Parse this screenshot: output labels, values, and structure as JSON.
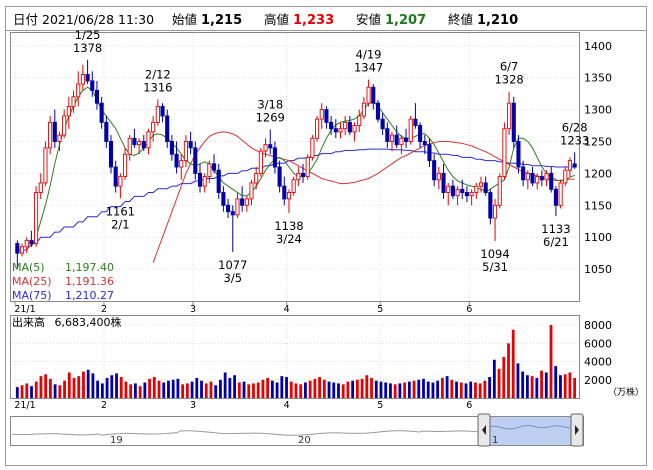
{
  "header": {
    "date_label": "日付",
    "datetime": "2021/06/28 11:30",
    "open_label": "始値",
    "open": "1,215",
    "high_label": "高値",
    "high": "1,233",
    "low_label": "安値",
    "low": "1,207",
    "close_label": "終値",
    "close": "1,210"
  },
  "colors": {
    "up": "#e60000",
    "down": "#0000aa",
    "ma5": "#2e7d1e",
    "ma25": "#e03030",
    "ma75": "#2a2ae0",
    "high_value": "#e60000",
    "low_value": "#1a7a1a",
    "nav_fill": "#a8c0ee"
  },
  "legend": [
    {
      "label": "MA(5)",
      "value": "1,197.40",
      "color": "#2e7d1e"
    },
    {
      "label": "MA(25)",
      "value": "1,191.36",
      "color": "#e03030"
    },
    {
      "label": "MA(75)",
      "value": "1,210.27",
      "color": "#2a2ae0"
    }
  ],
  "volume": {
    "label": "出来高",
    "value": "6,683,400株",
    "unit": "（万株）"
  },
  "x_axis": {
    "main_ticks": [
      "21/1",
      "2",
      "3",
      "4",
      "5",
      "6"
    ],
    "volume_ticks": [
      "21/1",
      "2",
      "3",
      "4",
      "5",
      "6"
    ]
  },
  "navigator": {
    "labels": [
      "19",
      "20",
      "1"
    ]
  },
  "chart_data": [
    {
      "type": "candlestick",
      "title": "",
      "ylim": [
        1000,
        1420
      ],
      "yticks": [
        1050,
        1100,
        1150,
        1200,
        1250,
        1300,
        1350,
        1400
      ],
      "annotations": [
        {
          "date": "1/25",
          "value": 1378,
          "kind": "high"
        },
        {
          "date": "2/12",
          "value": 1316,
          "kind": "high"
        },
        {
          "date": "3/18",
          "value": 1269,
          "kind": "high"
        },
        {
          "date": "4/19",
          "value": 1347,
          "kind": "high"
        },
        {
          "date": "6/7",
          "value": 1328,
          "kind": "high"
        },
        {
          "date": "6/28",
          "value": 1233,
          "kind": "high"
        },
        {
          "date": "2/1",
          "value": 1161,
          "kind": "low"
        },
        {
          "date": "3/5",
          "value": 1077,
          "kind": "low"
        },
        {
          "date": "3/24",
          "value": 1138,
          "kind": "low"
        },
        {
          "date": "5/31",
          "value": 1094,
          "kind": "low"
        },
        {
          "date": "6/21",
          "value": 1133,
          "kind": "low"
        }
      ],
      "ohlc": [
        [
          1090,
          1095,
          1050,
          1075
        ],
        [
          1075,
          1090,
          1070,
          1085
        ],
        [
          1085,
          1100,
          1075,
          1095
        ],
        [
          1095,
          1110,
          1085,
          1090
        ],
        [
          1090,
          1180,
          1085,
          1170
        ],
        [
          1170,
          1200,
          1160,
          1185
        ],
        [
          1185,
          1250,
          1180,
          1240
        ],
        [
          1240,
          1290,
          1230,
          1280
        ],
        [
          1280,
          1300,
          1240,
          1250
        ],
        [
          1250,
          1265,
          1235,
          1260
        ],
        [
          1260,
          1300,
          1255,
          1290
        ],
        [
          1290,
          1320,
          1270,
          1305
        ],
        [
          1305,
          1330,
          1295,
          1320
        ],
        [
          1320,
          1360,
          1305,
          1340
        ],
        [
          1340,
          1370,
          1330,
          1355
        ],
        [
          1355,
          1378,
          1340,
          1345
        ],
        [
          1345,
          1360,
          1320,
          1330
        ],
        [
          1330,
          1345,
          1300,
          1310
        ],
        [
          1310,
          1320,
          1270,
          1280
        ],
        [
          1280,
          1290,
          1240,
          1250
        ],
        [
          1250,
          1260,
          1200,
          1210
        ],
        [
          1210,
          1220,
          1170,
          1180
        ],
        [
          1180,
          1200,
          1161,
          1195
        ],
        [
          1195,
          1240,
          1190,
          1230
        ],
        [
          1230,
          1260,
          1220,
          1255
        ],
        [
          1255,
          1270,
          1240,
          1245
        ],
        [
          1245,
          1255,
          1230,
          1250
        ],
        [
          1250,
          1260,
          1235,
          1240
        ],
        [
          1240,
          1270,
          1230,
          1265
        ],
        [
          1265,
          1290,
          1250,
          1280
        ],
        [
          1280,
          1316,
          1275,
          1305
        ],
        [
          1305,
          1310,
          1280,
          1290
        ],
        [
          1290,
          1300,
          1240,
          1250
        ],
        [
          1250,
          1260,
          1220,
          1230
        ],
        [
          1230,
          1250,
          1200,
          1210
        ],
        [
          1210,
          1230,
          1190,
          1220
        ],
        [
          1220,
          1260,
          1210,
          1250
        ],
        [
          1250,
          1265,
          1230,
          1240
        ],
        [
          1240,
          1250,
          1190,
          1200
        ],
        [
          1200,
          1215,
          1170,
          1180
        ],
        [
          1180,
          1200,
          1170,
          1195
        ],
        [
          1195,
          1220,
          1185,
          1215
        ],
        [
          1215,
          1230,
          1200,
          1205
        ],
        [
          1205,
          1215,
          1160,
          1170
        ],
        [
          1170,
          1180,
          1140,
          1150
        ],
        [
          1150,
          1160,
          1130,
          1140
        ],
        [
          1140,
          1150,
          1077,
          1135
        ],
        [
          1135,
          1170,
          1130,
          1160
        ],
        [
          1160,
          1180,
          1140,
          1150
        ],
        [
          1150,
          1165,
          1140,
          1160
        ],
        [
          1160,
          1190,
          1150,
          1185
        ],
        [
          1185,
          1210,
          1175,
          1200
        ],
        [
          1200,
          1240,
          1195,
          1235
        ],
        [
          1235,
          1255,
          1225,
          1245
        ],
        [
          1245,
          1269,
          1230,
          1240
        ],
        [
          1240,
          1250,
          1200,
          1210
        ],
        [
          1210,
          1220,
          1170,
          1180
        ],
        [
          1180,
          1195,
          1150,
          1160
        ],
        [
          1160,
          1175,
          1138,
          1170
        ],
        [
          1170,
          1195,
          1165,
          1190
        ],
        [
          1190,
          1210,
          1180,
          1200
        ],
        [
          1200,
          1215,
          1185,
          1195
        ],
        [
          1195,
          1230,
          1190,
          1225
        ],
        [
          1225,
          1260,
          1220,
          1255
        ],
        [
          1255,
          1290,
          1250,
          1285
        ],
        [
          1285,
          1310,
          1270,
          1300
        ],
        [
          1300,
          1305,
          1270,
          1280
        ],
        [
          1280,
          1290,
          1260,
          1270
        ],
        [
          1270,
          1285,
          1255,
          1265
        ],
        [
          1265,
          1280,
          1255,
          1270
        ],
        [
          1270,
          1290,
          1260,
          1280
        ],
        [
          1280,
          1290,
          1260,
          1265
        ],
        [
          1265,
          1280,
          1250,
          1275
        ],
        [
          1275,
          1300,
          1265,
          1290
        ],
        [
          1290,
          1320,
          1285,
          1310
        ],
        [
          1310,
          1347,
          1305,
          1335
        ],
        [
          1335,
          1340,
          1300,
          1310
        ],
        [
          1310,
          1315,
          1280,
          1285
        ],
        [
          1285,
          1295,
          1260,
          1270
        ],
        [
          1270,
          1280,
          1240,
          1250
        ],
        [
          1250,
          1265,
          1235,
          1260
        ],
        [
          1260,
          1275,
          1240,
          1245
        ],
        [
          1245,
          1260,
          1230,
          1255
        ],
        [
          1255,
          1270,
          1240,
          1250
        ],
        [
          1250,
          1290,
          1245,
          1285
        ],
        [
          1285,
          1310,
          1270,
          1275
        ],
        [
          1275,
          1280,
          1240,
          1250
        ],
        [
          1250,
          1260,
          1230,
          1245
        ],
        [
          1245,
          1255,
          1210,
          1220
        ],
        [
          1220,
          1230,
          1180,
          1190
        ],
        [
          1190,
          1210,
          1175,
          1200
        ],
        [
          1200,
          1215,
          1160,
          1170
        ],
        [
          1170,
          1185,
          1150,
          1180
        ],
        [
          1180,
          1190,
          1160,
          1165
        ],
        [
          1165,
          1180,
          1150,
          1175
        ],
        [
          1175,
          1190,
          1160,
          1170
        ],
        [
          1170,
          1180,
          1155,
          1165
        ],
        [
          1165,
          1175,
          1150,
          1170
        ],
        [
          1170,
          1185,
          1160,
          1180
        ],
        [
          1180,
          1195,
          1170,
          1185
        ],
        [
          1185,
          1195,
          1165,
          1170
        ],
        [
          1170,
          1175,
          1120,
          1130
        ],
        [
          1130,
          1160,
          1094,
          1150
        ],
        [
          1150,
          1200,
          1145,
          1195
        ],
        [
          1195,
          1280,
          1190,
          1270
        ],
        [
          1270,
          1328,
          1260,
          1310
        ],
        [
          1310,
          1320,
          1240,
          1250
        ],
        [
          1250,
          1260,
          1200,
          1210
        ],
        [
          1210,
          1220,
          1180,
          1190
        ],
        [
          1190,
          1205,
          1175,
          1200
        ],
        [
          1200,
          1210,
          1180,
          1185
        ],
        [
          1185,
          1200,
          1175,
          1195
        ],
        [
          1195,
          1205,
          1180,
          1190
        ],
        [
          1190,
          1205,
          1180,
          1200
        ],
        [
          1200,
          1210,
          1170,
          1175
        ],
        [
          1175,
          1180,
          1133,
          1150
        ],
        [
          1150,
          1190,
          1145,
          1185
        ],
        [
          1185,
          1210,
          1180,
          1205
        ],
        [
          1205,
          1225,
          1195,
          1220
        ],
        [
          1215,
          1233,
          1207,
          1210
        ]
      ],
      "ma5": [
        1085,
        1100,
        1125,
        1150,
        1180,
        1215,
        1245,
        1270,
        1290,
        1305,
        1320,
        1330,
        1335,
        1330,
        1315,
        1300,
        1290,
        1280,
        1270,
        1255,
        1240,
        1230,
        1228,
        1232,
        1240,
        1250,
        1260,
        1262,
        1260,
        1255,
        1248,
        1240,
        1230,
        1220,
        1215,
        1212,
        1215,
        1218,
        1215,
        1205,
        1195,
        1185,
        1180,
        1175,
        1170,
        1165,
        1165,
        1170,
        1180,
        1192,
        1205,
        1215,
        1222,
        1225,
        1220,
        1210,
        1200,
        1195,
        1195,
        1200,
        1210,
        1222,
        1240,
        1255,
        1268,
        1276,
        1280,
        1282,
        1283,
        1285,
        1290,
        1300,
        1310,
        1312,
        1306,
        1295,
        1285,
        1275,
        1265,
        1258,
        1255,
        1255,
        1258,
        1262,
        1262,
        1255,
        1245,
        1232,
        1218,
        1205,
        1195,
        1188,
        1185,
        1182,
        1180,
        1178,
        1175,
        1172,
        1175,
        1180,
        1185,
        1190,
        1210,
        1240,
        1255,
        1255,
        1250,
        1240,
        1225,
        1210,
        1200,
        1195,
        1190,
        1188,
        1190,
        1194,
        1197
      ],
      "ma25": [
        1060,
        1080,
        1100,
        1120,
        1140,
        1160,
        1180,
        1200,
        1215,
        1230,
        1240,
        1250,
        1258,
        1262,
        1264,
        1265,
        1264,
        1262,
        1258,
        1252,
        1246,
        1240,
        1236,
        1232,
        1230,
        1228,
        1226,
        1224,
        1222,
        1220,
        1216,
        1212,
        1208,
        1204,
        1200,
        1196,
        1192,
        1190,
        1188,
        1186,
        1184,
        1184,
        1185,
        1186,
        1188,
        1190,
        1192,
        1196,
        1200,
        1205,
        1210,
        1215,
        1220,
        1225,
        1228,
        1232,
        1236,
        1240,
        1244,
        1246,
        1248,
        1250,
        1250,
        1250,
        1249,
        1248,
        1247,
        1245,
        1243,
        1240,
        1237,
        1234,
        1230,
        1226,
        1222,
        1218,
        1214,
        1210,
        1206,
        1203,
        1200,
        1198,
        1196,
        1194,
        1192,
        1190,
        1189,
        1189,
        1190,
        1191,
        1191
      ],
      "ma75": [
        1080,
        1090,
        1100,
        1108,
        1116,
        1124,
        1132,
        1140,
        1148,
        1156,
        1164,
        1170,
        1176,
        1180,
        1184,
        1188,
        1192,
        1196,
        1200,
        1204,
        1208,
        1212,
        1216,
        1220,
        1224,
        1228,
        1231,
        1234,
        1236,
        1237,
        1238,
        1238,
        1237,
        1236,
        1234,
        1232,
        1230,
        1228,
        1225,
        1222,
        1220,
        1218,
        1216,
        1214,
        1212,
        1211,
        1210,
        1210
      ],
      "ylabel": ""
    },
    {
      "type": "bar",
      "title": "",
      "ylim": [
        0,
        9000
      ],
      "yticks": [
        2000,
        4000,
        6000,
        8000
      ],
      "values": [
        1200,
        1400,
        1600,
        1300,
        1800,
        2400,
        2600,
        2100,
        1500,
        1400,
        1900,
        2800,
        2200,
        2400,
        2900,
        3100,
        2700,
        1900,
        1600,
        2200,
        2500,
        2700,
        2300,
        1800,
        1500,
        1600,
        1300,
        1700,
        2100,
        2300,
        1900,
        1700,
        1900,
        2000,
        2100,
        1500,
        1600,
        1800,
        2200,
        1900,
        1600,
        1800,
        1400,
        2000,
        2800,
        2200,
        2500,
        1700,
        1800,
        1500,
        1600,
        1700,
        2000,
        2200,
        1900,
        1700,
        2400,
        2300,
        1800,
        1600,
        1500,
        1700,
        1900,
        2100,
        2300,
        2000,
        1800,
        1700,
        1600,
        1500,
        1800,
        1900,
        2000,
        2100,
        2500,
        2200,
        1900,
        1800,
        1700,
        1600,
        1500,
        1600,
        1700,
        1800,
        1900,
        2000,
        2100,
        1800,
        1700,
        1900,
        2200,
        2400,
        2000,
        1800,
        1700,
        1600,
        1800,
        1700,
        1600,
        1900,
        2300,
        4200,
        3200,
        4500,
        6000,
        7500,
        3800,
        2900,
        2500,
        2400,
        2200,
        3000,
        2800,
        8000,
        3500,
        2500,
        2600,
        2800,
        2200
      ],
      "ylabel": ""
    }
  ]
}
